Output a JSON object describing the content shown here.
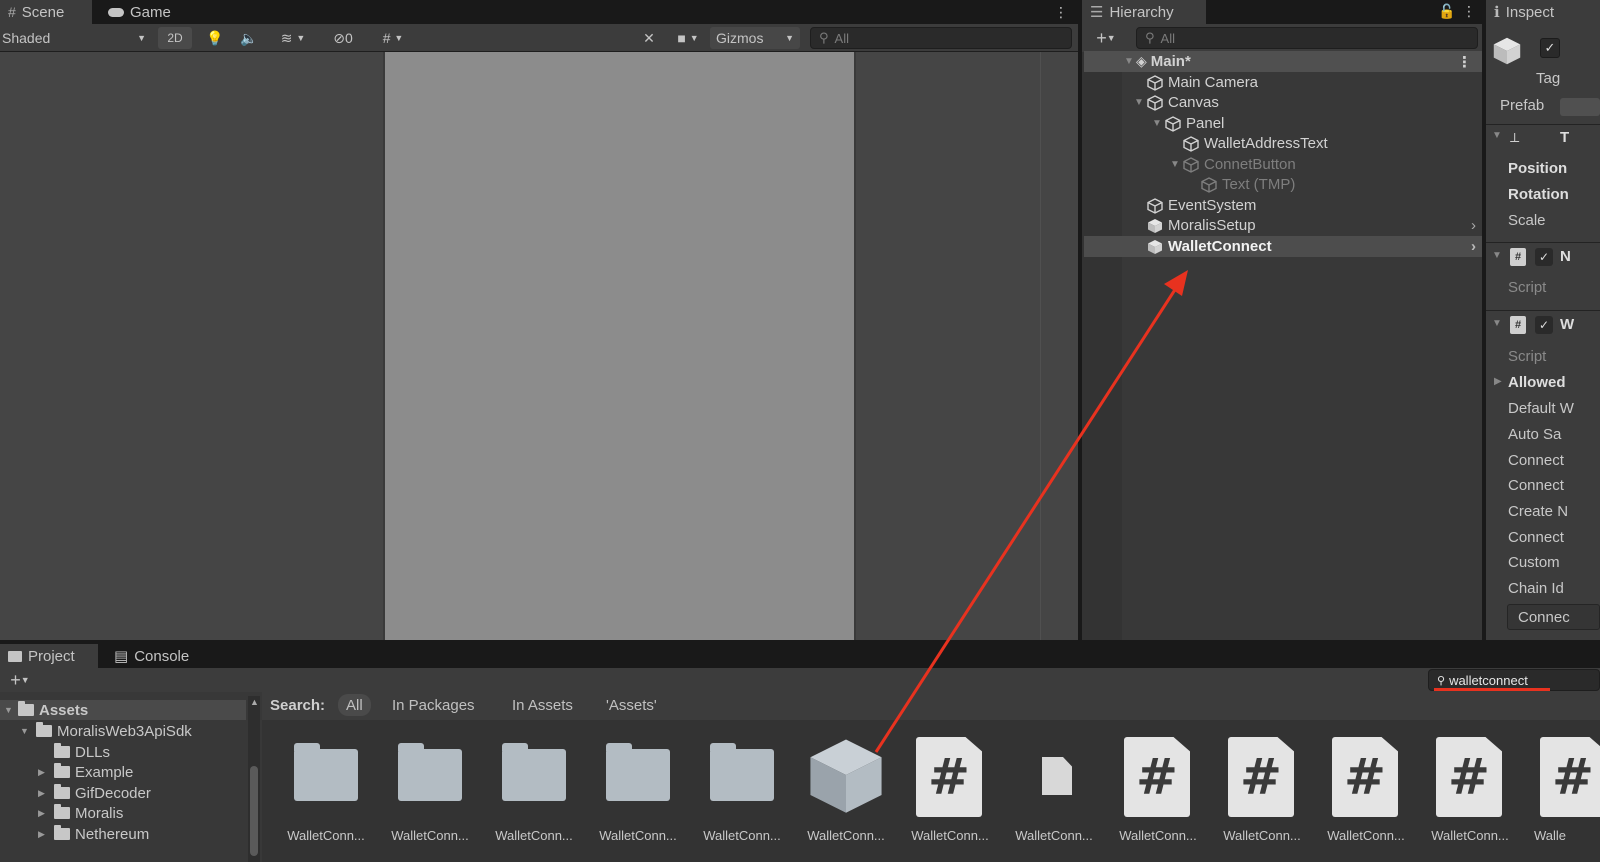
{
  "scene_panel": {
    "tabs": [
      {
        "label": "Scene",
        "icon": "hash-icon"
      },
      {
        "label": "Game",
        "icon": "gamepad-icon"
      }
    ],
    "shading_mode": "Shaded",
    "toggle_2d": "2D",
    "hidden_count": "0",
    "gizmos_label": "Gizmos",
    "search_placeholder": "All"
  },
  "hierarchy": {
    "tab_label": "Hierarchy",
    "search_placeholder": "All",
    "rows": [
      {
        "label": "Main*",
        "depth": 0,
        "state": "scene"
      },
      {
        "label": "Main Camera",
        "depth": 1,
        "state": "normal"
      },
      {
        "label": "Canvas",
        "depth": 1,
        "state": "normal"
      },
      {
        "label": "Panel",
        "depth": 2,
        "state": "normal"
      },
      {
        "label": "WalletAddressText",
        "depth": 3,
        "state": "normal"
      },
      {
        "label": "ConnetButton",
        "depth": 3,
        "state": "dim"
      },
      {
        "label": "Text (TMP)",
        "depth": 4,
        "state": "dim"
      },
      {
        "label": "EventSystem",
        "depth": 1,
        "state": "normal"
      },
      {
        "label": "MoralisSetup",
        "depth": 1,
        "state": "normal"
      },
      {
        "label": "WalletConnect",
        "depth": 1,
        "state": "selected"
      }
    ]
  },
  "inspector": {
    "tab_label": "Inspect",
    "tag_label": "Tag",
    "prefab_label": "Prefab",
    "transform_header": "T",
    "fields": {
      "position": "Position",
      "rotation": "Rotation",
      "scale": "Scale",
      "component1_header": "N",
      "script1": "Script",
      "component2_header": "W",
      "script2": "Script",
      "allowed": "Allowed",
      "default": "Default W",
      "auto_save": "Auto Sa",
      "connect1": "Connect",
      "connect2": "Connect",
      "create": "Create N",
      "connect3": "Connect",
      "custom": "Custom",
      "chain_id": "Chain Id",
      "connect_button": "Connec"
    }
  },
  "project": {
    "tabs": [
      {
        "label": "Project",
        "icon": "folder-icon"
      },
      {
        "label": "Console",
        "icon": "console-icon"
      }
    ],
    "search_value": "walletconnect",
    "tree": [
      {
        "label": "Assets",
        "depth": 0
      },
      {
        "label": "MoralisWeb3ApiSdk",
        "depth": 1
      },
      {
        "label": "DLLs",
        "depth": 2
      },
      {
        "label": "Example",
        "depth": 2
      },
      {
        "label": "GifDecoder",
        "depth": 2
      },
      {
        "label": "Moralis",
        "depth": 2
      },
      {
        "label": "Nethereum",
        "depth": 2
      }
    ],
    "search_filter_label": "Search:",
    "filters": [
      "All",
      "In Packages",
      "In Assets",
      "'Assets'"
    ],
    "assets": [
      {
        "label": "WalletConn...",
        "kind": "folder"
      },
      {
        "label": "WalletConn...",
        "kind": "folder"
      },
      {
        "label": "WalletConn...",
        "kind": "folder"
      },
      {
        "label": "WalletConn...",
        "kind": "folder"
      },
      {
        "label": "WalletConn...",
        "kind": "folder"
      },
      {
        "label": "WalletConn...",
        "kind": "prefab"
      },
      {
        "label": "WalletConn...",
        "kind": "script"
      },
      {
        "label": "WalletConn...",
        "kind": "file"
      },
      {
        "label": "WalletConn...",
        "kind": "script"
      },
      {
        "label": "WalletConn...",
        "kind": "script"
      },
      {
        "label": "WalletConn...",
        "kind": "script"
      },
      {
        "label": "WalletConn...",
        "kind": "script"
      },
      {
        "label": "Walle",
        "kind": "script"
      }
    ]
  },
  "colors": {
    "annotation_arrow": "#e8321f",
    "selection": "#4d4d4d",
    "panel_bg": "#282828"
  }
}
